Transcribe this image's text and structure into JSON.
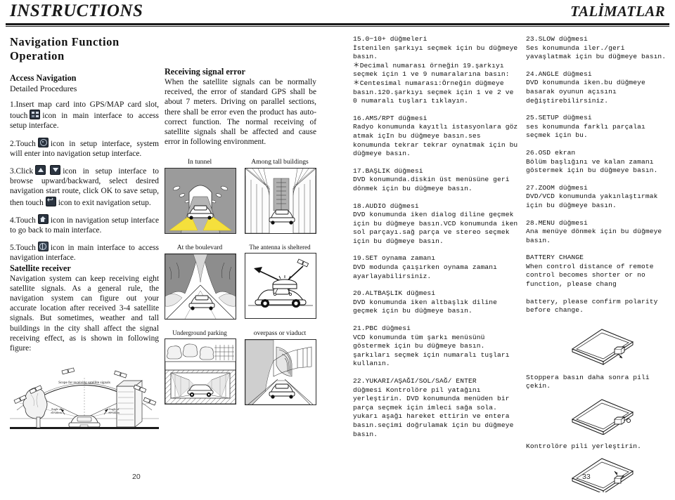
{
  "header": {
    "left_title": "INSTRUCTIONS",
    "right_title": "TALİMATLAR"
  },
  "page_numbers": {
    "left": "20",
    "right": "33"
  },
  "column1": {
    "heading": "Navigation Function Operation",
    "subheading_1": "Access Navigation",
    "subheading_2": "Detailed Procedures",
    "step1_a": "1.Insert map card into GPS/MAP card slot, touch",
    "step1_b": "icon in main interface to access setup interface.",
    "step2_a": "2.Touch",
    "step2_b": "icon in setup interface, system will enter into navigation setup interface.",
    "step3_a": "3.Click",
    "step3_b": "icon in setup interface to browse upward/backward, select desired navigation start route, click OK to save setup, then touch",
    "step3_c": "icon to exit navigation setup.",
    "step4_a": "4.Touch",
    "step4_b": "icon in navigation setup interface to go back to main interface.",
    "step5_a": "5.Touch",
    "step5_b": "icon in main interface to access navigation interface.",
    "satellite_heading": "Satellite receiver",
    "satellite_text": "Navigation system can keep receiving eight satellite signals. As a general rule, the navigation system can figure out your accurate location after received 3-4 satellite signals. But sometimes, weather and tall buildings in the city shall affect the signal receiving effect, as is shown in following figure:",
    "diagram_labels": {
      "scope": "Scope for receiving satellite signals",
      "angle_left": "Angle of elevation",
      "angle_right": "Angle of elevation"
    },
    "icons": {
      "grid": "grid-icon",
      "gear": "gear-icon",
      "up": "arrow-up-icon",
      "down": "arrow-down-icon",
      "back": "back-arrow-icon",
      "home": "home-icon",
      "globe": "globe-icon"
    }
  },
  "column2": {
    "heading": "Receiving signal error",
    "body": "When the satellite signals can be normally received, the error of standard GPS shall be about 7 meters. Driving on parallel sections, there shall be error even the product has auto-correct function. The normal receiving of satellite signals shall be affected and cause error in following environment.",
    "figures": [
      {
        "caption": "In tunnel"
      },
      {
        "caption": "Among tall buildings"
      },
      {
        "caption": "At the boulevard"
      },
      {
        "caption": "The antenna is sheltered"
      },
      {
        "caption": "Underground parking"
      },
      {
        "caption": "overpass or viaduct"
      }
    ]
  },
  "column3": {
    "entries": [
      {
        "title": "15.0−10+ düğmeleri",
        "body": "İstenilen şarkıyı seçmek için bu düğmeye basın.\n＊Decimal numarası örneğin 19.şarkıyı seçmek için 1 ve 9 numaralarına basın:\n＊Centesimal numarası:Örneğin düğmeye basın.120.şarkıyı seçmek için 1 ve 2 ve 0 numaralı tuşları tıklayın."
      },
      {
        "title": "16.AMS/RPT düğmesi",
        "body": "Radyo konumunda kayıtlı istasyonlara göz atmak içIn bu düğmeye basın.ses konumunda tekrar tekrar oynatmak için bu düğmeye basın."
      },
      {
        "title": "17.BAŞLIK düğmesi",
        "body": "DVD konumunda.diskin üst menüsüne geri dönmek için bu düğmeye basın."
      },
      {
        "title": "18.AUDIO düğmesi",
        "body": "DVD konumunda iken  dialog diline geçmek için bu düğmeye basın.VCD konumunda iken sol parçayı.sağ parça ve stereo seçmek için bu düğmeye basın."
      },
      {
        "title": "19.SET oynama zamanı",
        "body": "DVD modunda çaışırken oynama zamanı ayarlayabilirsiniz."
      },
      {
        "title": "20.ALTBAŞLIK düğmesi",
        "body": "DVD konumunda iken altbaşlık diline geçmek için bu düğmeye basın."
      },
      {
        "title": "21.PBC düğmesi",
        "body": "VCD konumunda tüm şarkı menüsünü göstermek için bu düğmeye basın.\nşarkıları seçmek için numaralı tuşları kullanın."
      },
      {
        "title": "22.YUKARI/AŞAĞI/SOL/SAĞ/ ENTER",
        "body": "düğmesi  Kontrolöre pil yatağını yerleştirin. DVD konumunda menüden bir parça seçmek için imleci sağa sola.\nyukarı aşağı hareket ettirin ve entera basın.seçimi doğrulamak için bu düğmeye basın."
      }
    ]
  },
  "column4": {
    "entries": [
      {
        "title": "23.SLOW düğmesi",
        "body": "Ses konumunda iler./geri yavaşlatmak için bu düğmeye basın."
      },
      {
        "title": "24.ANGLE düğmesi",
        "body": "DVD konumunda iken.bu düğmeye basarak oyunun açısını değiştirebilirsiniz."
      },
      {
        "title": "25.SETUP düğmesi",
        "body": "ses konumunda farklı parçalaı seçmek için bu."
      },
      {
        "title": "26.OSD ekran",
        "body": "Bölüm başlığını ve kalan zamanı göstermek için bu düğmeye basın."
      },
      {
        "title": "27.ZOOM düğmesi",
        "body": "DVD/VCD konumunda yakınlaştırmak için bu düğmeye basın."
      },
      {
        "title": "28.MENU düğmesi",
        "body": "Ana menüye dönmek için bu düğmeye basın."
      },
      {
        "title": "BATTERY CHANGE",
        "body": "When control distance of remote control becomes shorter or no function, please chang"
      },
      {
        "title": "",
        "body": "battery, please confirm polarity before change."
      }
    ],
    "caption_remove": "Stoppera basın daha sonra pili çekin.",
    "caption_insert": "Kontrolöre pili yerleştirin."
  }
}
